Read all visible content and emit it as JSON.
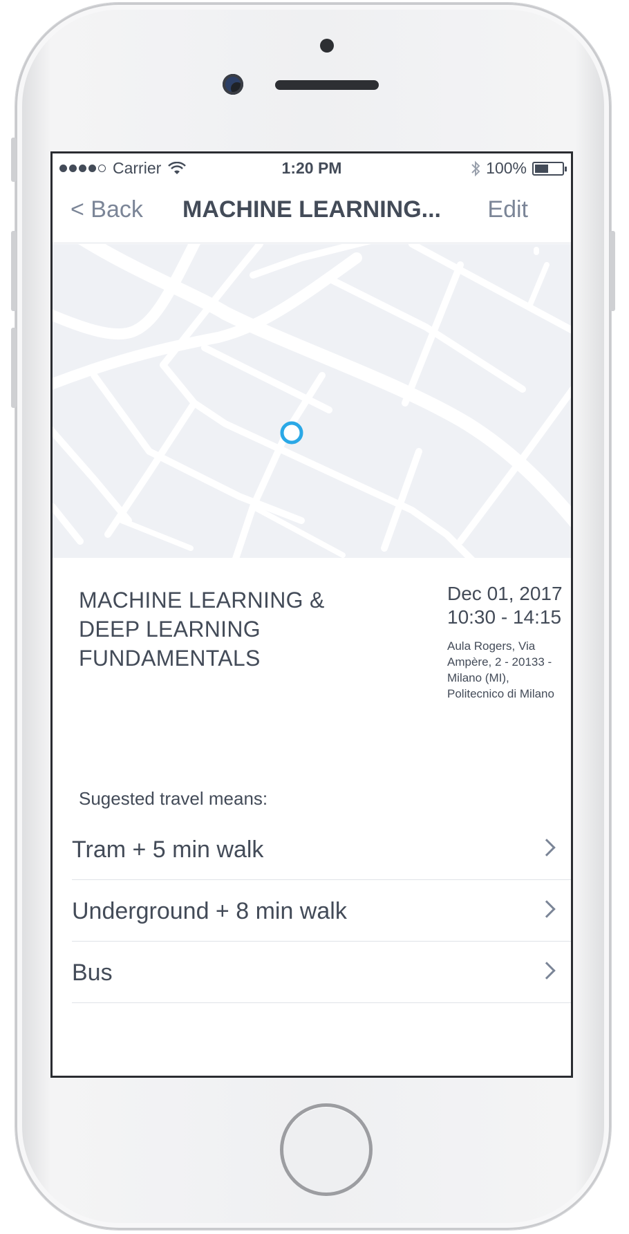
{
  "status_bar": {
    "carrier": "Carrier",
    "time": "1:20 PM",
    "battery": "100%",
    "battery_level": 0.5,
    "signal_bars": 4,
    "icons": [
      "wifi-icon",
      "bluetooth-icon",
      "battery-icon"
    ]
  },
  "nav": {
    "back_label": "< Back",
    "title": "MACHINE LEARNING...",
    "edit_label": "Edit"
  },
  "event": {
    "title_lines": [
      "MACHINE LEARNING &",
      "DEEP LEARNING",
      "FUNDAMENTALS"
    ],
    "date": "Dec 01, 2017",
    "time_range": "10:30 - 14:15",
    "address_lines": [
      "Aula Rogers, Via",
      "Ampère, 2 - 20133 -",
      "Milano (MI),",
      "Politecnico di Milano"
    ]
  },
  "travel": {
    "header": "Sugested travel means:",
    "options": [
      {
        "label": "Tram + 5 min walk"
      },
      {
        "label": "Underground + 8 min walk"
      },
      {
        "label": "Bus"
      }
    ]
  },
  "colors": {
    "text": "#434b58",
    "accent": "#7b8597",
    "map_bg": "#eff1f5",
    "map_pin": "#2aa8e6",
    "divider": "#dfe2e7"
  }
}
